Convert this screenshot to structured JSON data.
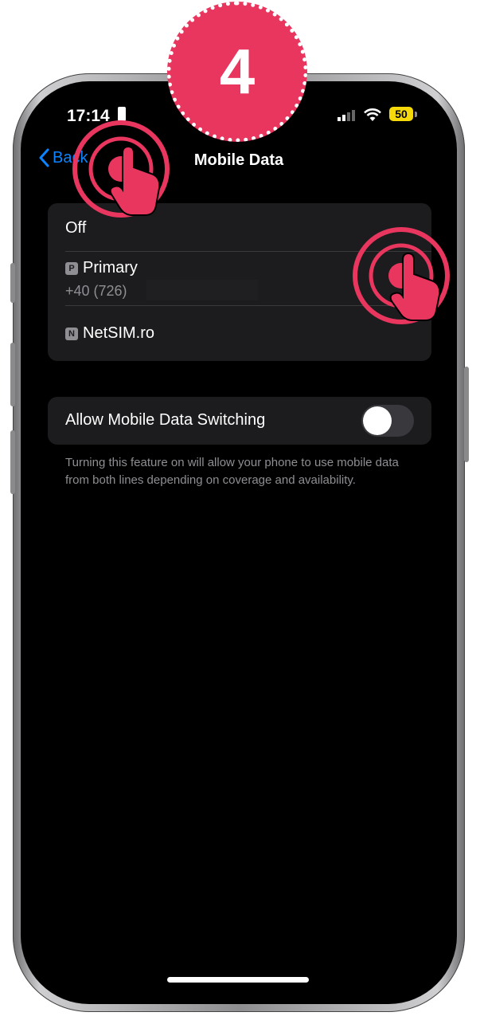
{
  "step": {
    "number": "4"
  },
  "status_bar": {
    "time": "17:14",
    "battery": "50"
  },
  "nav": {
    "back_label": "Back",
    "title": "Mobile Data"
  },
  "lines": {
    "off_label": "Off",
    "primary": {
      "badge": "P",
      "label": "Primary",
      "number": "+40 (726)"
    },
    "netsim": {
      "badge": "N",
      "label": "NetSIM.ro"
    }
  },
  "switching": {
    "label": "Allow Mobile Data Switching",
    "enabled": false,
    "footer": "Turning this feature on will allow your phone to use mobile data from both lines depending on coverage and availability."
  },
  "colors": {
    "accent": "#0a84ff",
    "badge": "#e8365f",
    "cell_background": "#1c1c1e",
    "battery": "#f5d90a"
  },
  "icons": [
    "chevron-left-icon",
    "lock-icon",
    "signal-icon",
    "wifi-icon",
    "battery-icon",
    "tap-hand-icon"
  ]
}
